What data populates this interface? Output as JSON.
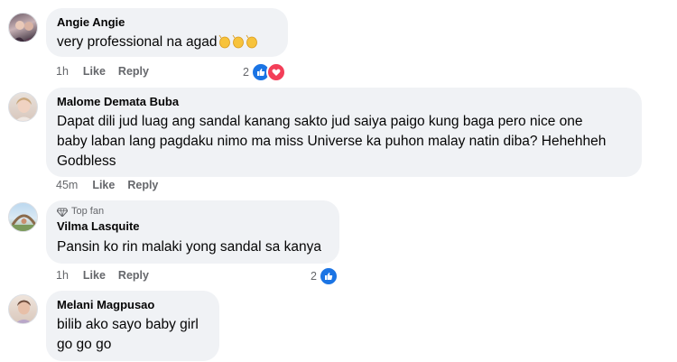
{
  "comments": [
    {
      "author": "Angie Angie",
      "text": "very professional na agad",
      "emojis": [
        "clapping-hands",
        "clapping-hands",
        "clapping-hands"
      ],
      "time": "1h",
      "like_label": "Like",
      "reply_label": "Reply",
      "reaction_count": "2",
      "reactions": [
        "like",
        "love"
      ]
    },
    {
      "author": "Malome Demata Buba",
      "text_lines": [
        "Dapat dili jud luag ang sandal kanang sakto jud saiya paigo kung baga pero nice one",
        "baby laban lang pagdaku nimo ma miss Universe ka puhon malay natin diba? Hehehheh",
        "Godbless"
      ],
      "time": "45m",
      "like_label": "Like",
      "reply_label": "Reply"
    },
    {
      "badge": "Top fan",
      "author": "Vilma Lasquite",
      "text": "Pansin ko rin malaki yong sandal sa kanya",
      "time": "1h",
      "like_label": "Like",
      "reply_label": "Reply",
      "reaction_count": "2",
      "reactions": [
        "like"
      ]
    },
    {
      "author": "Melani Magpusao",
      "text_lines": [
        "bilib ako sayo baby girl",
        "go go go"
      ]
    }
  ],
  "colors": {
    "bubble": "#f0f2f5",
    "meta_text": "#65676b",
    "like_blue": "#1b74e4",
    "love_red": "#f33e58"
  }
}
